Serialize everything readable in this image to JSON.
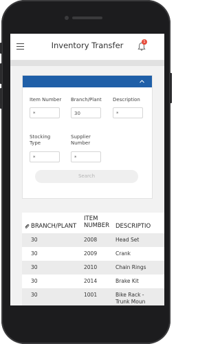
{
  "header": {
    "title": "Inventory Transfer",
    "notification_count": "1"
  },
  "filters": {
    "item_number_label": "Item Number",
    "item_number_value": "*",
    "branch_plant_label": "Branch/Plant",
    "branch_plant_value": "30",
    "description_label": "Description",
    "description_value": "*",
    "stocking_type_label_1": "Stocking",
    "stocking_type_label_2": "Type",
    "stocking_type_value": "*",
    "supplier_number_label_1": "Supplier",
    "supplier_number_label_2": "Number",
    "supplier_number_value": "*",
    "search_label": "Search"
  },
  "table": {
    "columns": {
      "branch_plant": "BRANCH/PLANT",
      "item_number_1": "ITEM",
      "item_number_2": "NUMBER",
      "description": "DESCRIPTIO"
    },
    "rows": [
      {
        "branch_plant": "30",
        "item_number": "2008",
        "description": "Head Set",
        "description_2": ""
      },
      {
        "branch_plant": "30",
        "item_number": "2009",
        "description": "Crank",
        "description_2": ""
      },
      {
        "branch_plant": "30",
        "item_number": "2010",
        "description": "Chain Rings",
        "description_2": ""
      },
      {
        "branch_plant": "30",
        "item_number": "2014",
        "description": "Brake Kit",
        "description_2": ""
      },
      {
        "branch_plant": "30",
        "item_number": "1001",
        "description": "Bike Rack -",
        "description_2": "Trunk Moun"
      }
    ]
  },
  "colors": {
    "accent": "#1f5fa8",
    "badge": "#e74c3c"
  }
}
